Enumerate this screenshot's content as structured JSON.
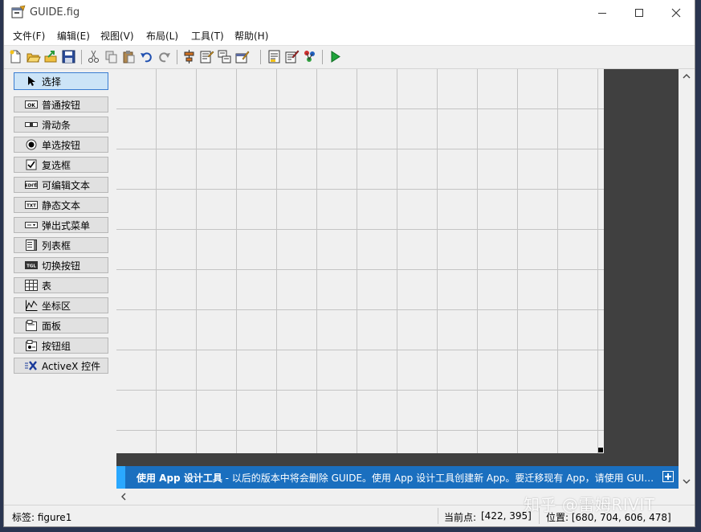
{
  "window": {
    "title": "GUIDE.fig"
  },
  "menu": [
    "文件(F)",
    "编辑(E)",
    "视图(V)",
    "布局(L)",
    "工具(T)",
    "帮助(H)"
  ],
  "toolbar": [
    {
      "icon": "new-icon"
    },
    {
      "icon": "open-icon"
    },
    {
      "icon": "export-icon"
    },
    {
      "icon": "save-icon"
    },
    {
      "icon": "cut-icon"
    },
    {
      "icon": "copy-icon"
    },
    {
      "icon": "paste-icon"
    },
    {
      "icon": "undo-icon"
    },
    {
      "icon": "redo-icon"
    },
    {
      "icon": "align-icon"
    },
    {
      "icon": "menu-editor-icon"
    },
    {
      "icon": "tab-order-icon"
    },
    {
      "icon": "toolbar-editor-icon"
    },
    {
      "icon": "editor-icon"
    },
    {
      "icon": "property-inspector-icon"
    },
    {
      "icon": "object-browser-icon"
    },
    {
      "icon": "run-icon"
    }
  ],
  "palette": [
    {
      "label": "选择",
      "icon": "pointer-icon",
      "selected": true
    },
    {
      "label": "普通按钮",
      "icon": "push-button-icon"
    },
    {
      "label": "滑动条",
      "icon": "slider-icon"
    },
    {
      "label": "单选按钮",
      "icon": "radio-button-icon"
    },
    {
      "label": "复选框",
      "icon": "checkbox-icon"
    },
    {
      "label": "可编辑文本",
      "icon": "edit-text-icon"
    },
    {
      "label": "静态文本",
      "icon": "static-text-icon"
    },
    {
      "label": "弹出式菜单",
      "icon": "popup-menu-icon"
    },
    {
      "label": "列表框",
      "icon": "listbox-icon"
    },
    {
      "label": "切换按钮",
      "icon": "toggle-button-icon"
    },
    {
      "label": "表",
      "icon": "table-icon"
    },
    {
      "label": "坐标区",
      "icon": "axes-icon"
    },
    {
      "label": "面板",
      "icon": "panel-icon"
    },
    {
      "label": "按钮组",
      "icon": "button-group-icon"
    },
    {
      "label": "ActiveX 控件",
      "icon": "activex-icon"
    }
  ],
  "banner": {
    "bold": "使用 App 设计工具",
    "text": " - 以后的版本中将会删除 GUIDE。使用 App 设计工具创建新 App。要迁移现有 App，请使用 GUIDE t..."
  },
  "status": {
    "tag": "标签: figure1",
    "current_point_label": "当前点:",
    "current_point": "[422, 395]",
    "position": "位置: [680, 704, 606, 478]"
  },
  "watermark": "知乎 @雷姆RIVIT"
}
